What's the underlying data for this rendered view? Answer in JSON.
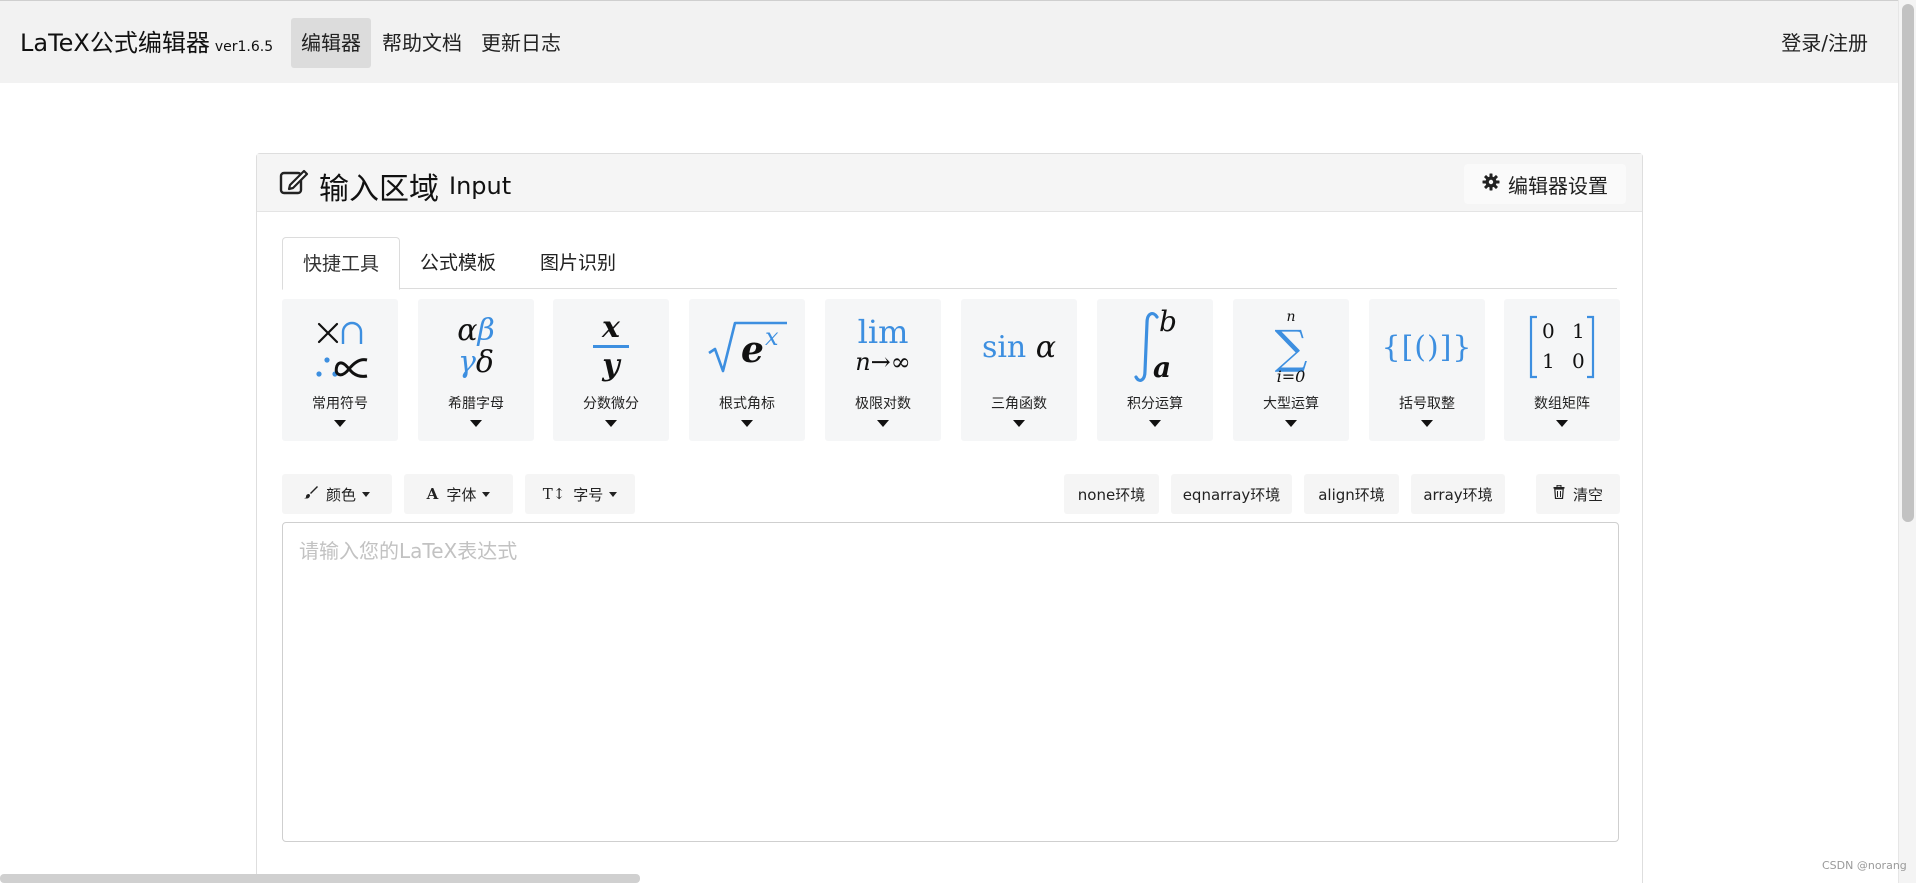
{
  "nav": {
    "brand": "LaTeX公式编辑器",
    "version": "ver1.6.5",
    "items": [
      {
        "label": "编辑器",
        "active": true
      },
      {
        "label": "帮助文档",
        "active": false
      },
      {
        "label": "更新日志",
        "active": false
      }
    ],
    "login": "登录/注册"
  },
  "panel": {
    "title": "输入区域",
    "title_en": "Input",
    "settings_label": "编辑器设置"
  },
  "tabs": [
    {
      "label": "快捷工具",
      "active": true
    },
    {
      "label": "公式模板",
      "active": false
    },
    {
      "label": "图片识别",
      "active": false
    }
  ],
  "tools": [
    {
      "label": "常用符号",
      "icon": "times-cap-therefore-propto"
    },
    {
      "label": "希腊字母",
      "icon": "alpha-beta-gamma-delta"
    },
    {
      "label": "分数微分",
      "icon": "fraction-x-over-y"
    },
    {
      "label": "根式角标",
      "icon": "sqrt-e-power-x"
    },
    {
      "label": "极限对数",
      "icon": "lim-n-to-infinity"
    },
    {
      "label": "三角函数",
      "icon": "sin-alpha"
    },
    {
      "label": "积分运算",
      "icon": "integral-a-to-b"
    },
    {
      "label": "大型运算",
      "icon": "sum-i-0-to-n"
    },
    {
      "label": "括号取整",
      "icon": "brackets"
    },
    {
      "label": "数组矩阵",
      "icon": "matrix-0-1-1-0"
    }
  ],
  "tool_symbols": {
    "greek_alpha": "α",
    "greek_beta": "β",
    "greek_gamma": "γ",
    "greek_delta": "δ",
    "frac_num": "x",
    "frac_den": "y",
    "root_base": "e",
    "root_exp": "x",
    "lim": "lim",
    "lim_sub": "n→∞",
    "sin": "sin",
    "sin_arg": "α",
    "int_upper": "b",
    "int_lower": "a",
    "sum_upper": "n",
    "sum_lower": "i=0",
    "brackets": "{[()]}",
    "matrix": [
      "0",
      "1",
      "1",
      "0"
    ]
  },
  "toolbar": {
    "color": "颜色",
    "font": "字体",
    "size": "字号",
    "env_none": "none环境",
    "env_eqnarray": "eqnarray环境",
    "env_align": "align环境",
    "env_array": "array环境",
    "clear": "清空"
  },
  "editor": {
    "placeholder": "请输入您的LaTeX表达式"
  },
  "watermark": "CSDN @norang",
  "colors": {
    "accent_blue": "#3d8fe0",
    "nav_bg": "#f2f2f2"
  }
}
